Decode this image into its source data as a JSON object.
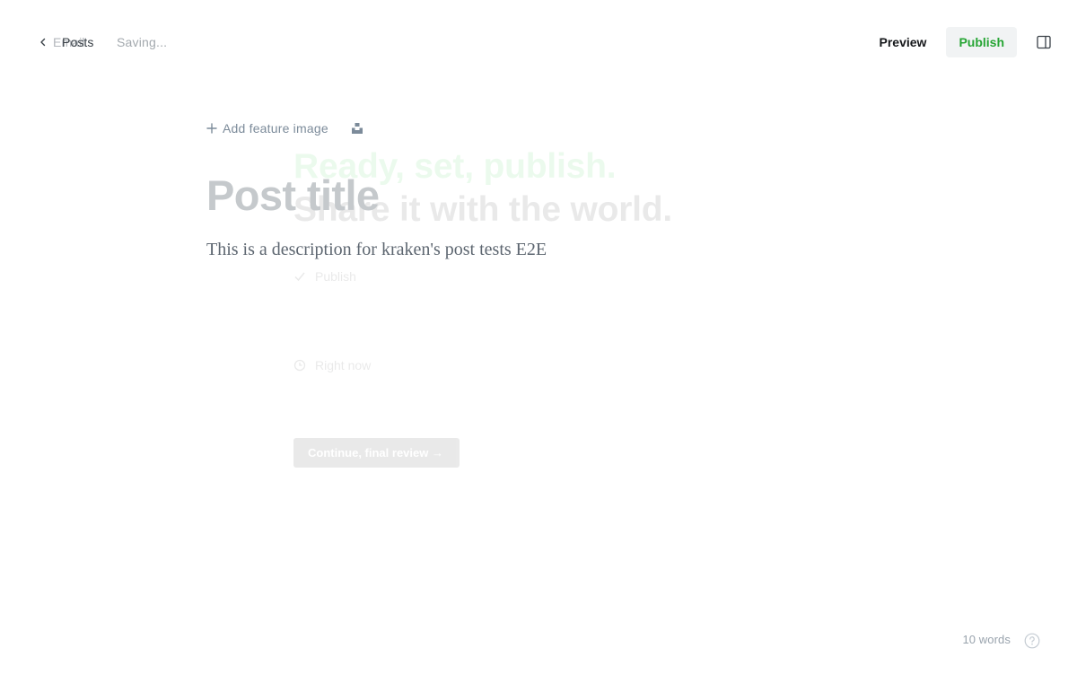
{
  "header": {
    "back_ghost_label": "Email",
    "back_label": "Posts",
    "status": "Saving...",
    "preview_label": "Preview",
    "publish_label": "Publish"
  },
  "publish_flow": {
    "headline_line1": "Ready, set, publish.",
    "headline_line2": "Share it with the world.",
    "option_publish": "Publish",
    "option_timing": "Right now",
    "continue_label": "Continue, final review →"
  },
  "editor": {
    "add_feature_image_label": "Add feature image",
    "title_placeholder": "Post title",
    "excerpt": "This is a description for kraken's post tests E2E"
  },
  "footer": {
    "word_count": "10 words"
  },
  "colors": {
    "accent_green": "#30cf43",
    "text_dark": "#15171a",
    "muted": "#7c8b9a"
  },
  "icons": {
    "back": "chevron-left-icon",
    "sidebar": "sidebar-toggle-icon",
    "add": "plus-icon",
    "unsplash": "unsplash-icon",
    "help": "help-circle-icon"
  }
}
